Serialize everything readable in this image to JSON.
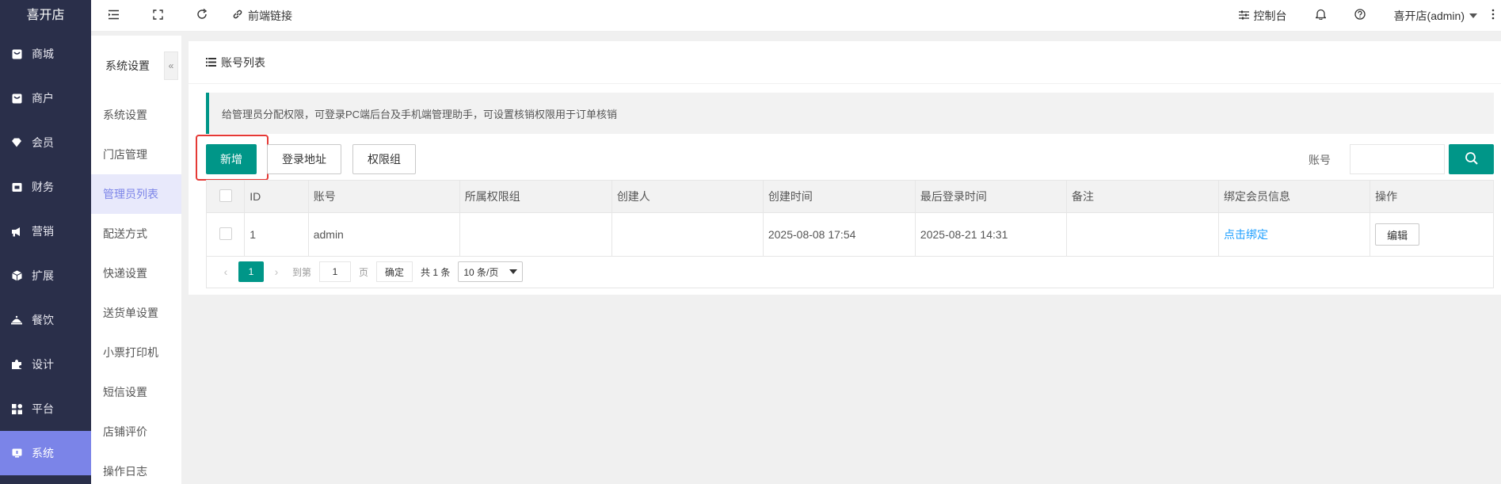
{
  "brand": "喜开店",
  "sidebar": {
    "items": [
      {
        "label": "商城",
        "icon": "shop-icon"
      },
      {
        "label": "商户",
        "icon": "merchant-icon"
      },
      {
        "label": "会员",
        "icon": "member-icon"
      },
      {
        "label": "财务",
        "icon": "finance-icon"
      },
      {
        "label": "营销",
        "icon": "marketing-icon"
      },
      {
        "label": "扩展",
        "icon": "extension-icon"
      },
      {
        "label": "餐饮",
        "icon": "catering-icon"
      },
      {
        "label": "设计",
        "icon": "design-icon"
      },
      {
        "label": "平台",
        "icon": "platform-icon"
      },
      {
        "label": "系统",
        "icon": "system-icon",
        "active": true
      }
    ]
  },
  "submenu": {
    "title": "系统设置",
    "collapse_glyph": "«",
    "items": [
      {
        "label": "系统设置"
      },
      {
        "label": "门店管理"
      },
      {
        "label": "管理员列表",
        "active": true
      },
      {
        "label": "配送方式"
      },
      {
        "label": "快递设置"
      },
      {
        "label": "送货单设置"
      },
      {
        "label": "小票打印机"
      },
      {
        "label": "短信设置"
      },
      {
        "label": "店铺评价"
      },
      {
        "label": "操作日志"
      }
    ]
  },
  "topbar": {
    "frontend_link": "前端链接",
    "control_panel": "控制台",
    "user": "喜开店(admin)"
  },
  "page": {
    "title": "账号列表",
    "tip": "给管理员分配权限，可登录PC端后台及手机端管理助手，可设置核销权限用于订单核销"
  },
  "toolbar": {
    "add": "新增",
    "login_url": "登录地址",
    "permission_group": "权限组",
    "search_label": "账号"
  },
  "table": {
    "headers": [
      "ID",
      "账号",
      "所属权限组",
      "创建人",
      "创建时间",
      "最后登录时间",
      "备注",
      "绑定会员信息",
      "操作"
    ],
    "rows": [
      {
        "id": "1",
        "account": "admin",
        "group": "",
        "creator": "",
        "created": "2025-08-08 17:54",
        "last_login": "2025-08-21 14:31",
        "remark": "",
        "bind": "点击绑定",
        "action": "编辑"
      }
    ]
  },
  "pager": {
    "current": "1",
    "goto": "到第",
    "page_input": "1",
    "page_unit": "页",
    "ok": "确定",
    "total": "共 1 条",
    "page_size": "10 条/页"
  },
  "colors": {
    "sidebar_bg": "#2a2f4a",
    "sidebar_active": "#7b84e8",
    "primary": "#009688",
    "link": "#1e9fff",
    "highlight": "#e53935"
  }
}
